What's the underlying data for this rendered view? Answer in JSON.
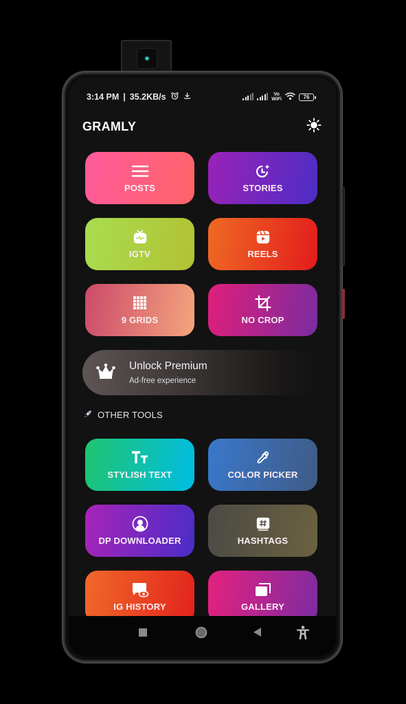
{
  "status_bar": {
    "time": "3:14 PM",
    "separator": "|",
    "network_speed": "35.2KB/s",
    "icons_left": [
      "alarm-icon",
      "download-icon"
    ],
    "icons_right": [
      "signal-sim1-icon",
      "signal-sim2-icon",
      "vowifi-icon",
      "wifi-icon",
      "battery-icon"
    ],
    "vowifi_top": "Vo",
    "vowifi_bottom": "WiFi",
    "battery_level": "76"
  },
  "app_bar": {
    "title": "GRAMLY",
    "theme_toggle_icon": "sun-icon"
  },
  "main_tools": [
    {
      "label": "POSTS",
      "icon": "menu-lines-icon",
      "colors": [
        "#ff5a9b",
        "#ff6468"
      ]
    },
    {
      "label": "STORIES",
      "icon": "clock-sparkle-icon",
      "colors": [
        "#9a22b8",
        "#4d2dc4"
      ]
    },
    {
      "label": "IGTV",
      "icon": "igtv-icon",
      "colors": [
        "#a8dd4f",
        "#b3c134"
      ]
    },
    {
      "label": "REELS",
      "icon": "reels-icon",
      "colors": [
        "#ef6a24",
        "#e21c1c"
      ]
    },
    {
      "label": "9 GRIDS",
      "icon": "grid-icon",
      "colors": [
        "#cc4a6a",
        "#f4a57e"
      ]
    },
    {
      "label": "NO CROP",
      "icon": "crop-icon",
      "colors": [
        "#e01e7a",
        "#7a2ca0"
      ]
    }
  ],
  "premium_banner": {
    "title": "Unlock Premium",
    "subtitle": "Ad-free experience",
    "icon": "crown-icon"
  },
  "section": {
    "emoji": "🚀",
    "title": "OTHER TOOLS"
  },
  "other_tools": [
    {
      "label": "STYLISH TEXT",
      "icon": "text-size-icon",
      "colors": [
        "#1fc46e",
        "#00bde4"
      ]
    },
    {
      "label": "COLOR PICKER",
      "icon": "eyedropper-icon",
      "colors": [
        "#3a78cc",
        "#3f5b86"
      ]
    },
    {
      "label": "DP DOWNLOADER",
      "icon": "profile-icon",
      "colors": [
        "#a824b8",
        "#4a2dc8"
      ]
    },
    {
      "label": "HASHTAGS",
      "icon": "hashtag-icon",
      "colors": [
        "#4b4a44",
        "#6b6240"
      ]
    },
    {
      "label": "IG HISTORY",
      "icon": "chat-eye-icon",
      "colors": [
        "#f0692a",
        "#e2231c"
      ]
    },
    {
      "label": "GALLERY",
      "icon": "gallery-icon",
      "colors": [
        "#e5217e",
        "#7d2ca2"
      ]
    }
  ],
  "nav_bar": {
    "buttons": [
      "recents-icon",
      "home-icon",
      "back-icon",
      "accessibility-icon"
    ]
  }
}
